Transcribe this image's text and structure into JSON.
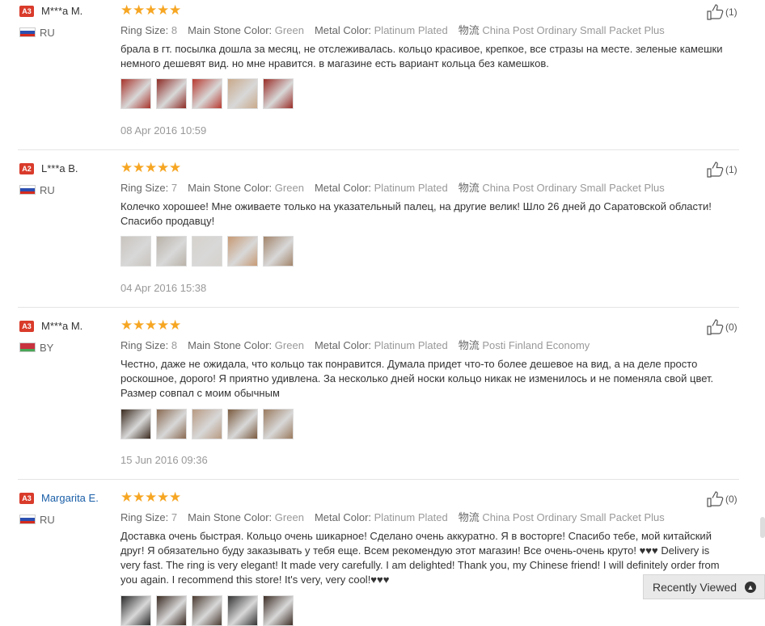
{
  "labels": {
    "ring_size": "Ring Size:",
    "main_stone": "Main Stone Color:",
    "metal": "Metal Color:",
    "shipping_prefix": "物流"
  },
  "recently_viewed": "Recently Viewed",
  "reviews": [
    {
      "badge": "A3",
      "name": "M***a M.",
      "country": "RU",
      "flag_colors": [
        "#ffffff",
        "#2b4fb0",
        "#d52b1e"
      ],
      "ring_size": "8",
      "stone": "Green",
      "metal": "Platinum Plated",
      "shipping": "China Post Ordinary Small Packet Plus",
      "text": "брала в гт. посылка дошла за месяц, не отслеживалась. кольцо красивое, крепкое, все стразы на месте. зеленые камешки немного дешевят вид. но мне нравится. в магазине есть вариант кольца без камешков.",
      "thumb_colors": [
        "#a8332b",
        "#8e2b25",
        "#b83a30",
        "#c9a98a",
        "#9a2d27"
      ],
      "date": "08 Apr 2016 10:59",
      "likes": "(1)",
      "name_link": false
    },
    {
      "badge": "A2",
      "name": "L***a B.",
      "country": "RU",
      "flag_colors": [
        "#ffffff",
        "#2b4fb0",
        "#d52b1e"
      ],
      "ring_size": "7",
      "stone": "Green",
      "metal": "Platinum Plated",
      "shipping": "China Post Ordinary Small Packet Plus",
      "text": "Колечко хорошее! Мне оживаете только на указательный палец, на другие велик! Шло 26 дней до Саратовской области! Спасибо продавцу!",
      "thumb_colors": [
        "#c9c4be",
        "#b9b2a8",
        "#d6d2cc",
        "#c79a74",
        "#a3856b"
      ],
      "date": "04 Apr 2016 15:38",
      "likes": "(1)",
      "name_link": false
    },
    {
      "badge": "A3",
      "name": "M***a M.",
      "country": "BY",
      "flag_colors": [
        "#c8313e",
        "#c8313e",
        "#4aa657"
      ],
      "ring_size": "8",
      "stone": "Green",
      "metal": "Platinum Plated",
      "shipping": "Posti Finland Economy",
      "text": "Честно, даже не ожидала, что кольцо так понравится. Думала придет что-то более дешевое на вид, а на деле просто роскошное, дорого! Я приятно удивлена. За несколько дней носки кольцо никак не изменилось и не поменяла свой цвет. Размер совпал с моим обычным",
      "thumb_colors": [
        "#3a2a1e",
        "#8a6a52",
        "#b89a82",
        "#7a5a3e",
        "#9a7a5e"
      ],
      "date": "15 Jun 2016 09:36",
      "likes": "(0)",
      "name_link": false
    },
    {
      "badge": "A3",
      "name": "Margarita E.",
      "country": "RU",
      "flag_colors": [
        "#ffffff",
        "#2b4fb0",
        "#d52b1e"
      ],
      "ring_size": "7",
      "stone": "Green",
      "metal": "Platinum Plated",
      "shipping": "China Post Ordinary Small Packet Plus",
      "text": "Доставка очень быстрая. Кольцо очень шикарное! Сделано очень аккуратно. Я в восторге! Спасибо тебе, мой китайский друг! Я обязательно буду заказывать у тебя еще. Всем рекомендую этот магазин! Все очень-очень круто! ♥♥♥ Delivery is very fast. The ring is very elegant! It made very carefully. I am delighted! Thank you, my Chinese friend! I will definitely order from you again. I recommend this store! It's very, very cool!♥♥♥",
      "thumb_colors": [
        "#2a2a2a",
        "#3a2a22",
        "#4a3a30",
        "#333333",
        "#3e2e26"
      ],
      "date": "",
      "likes": "(0)",
      "name_link": true
    }
  ]
}
